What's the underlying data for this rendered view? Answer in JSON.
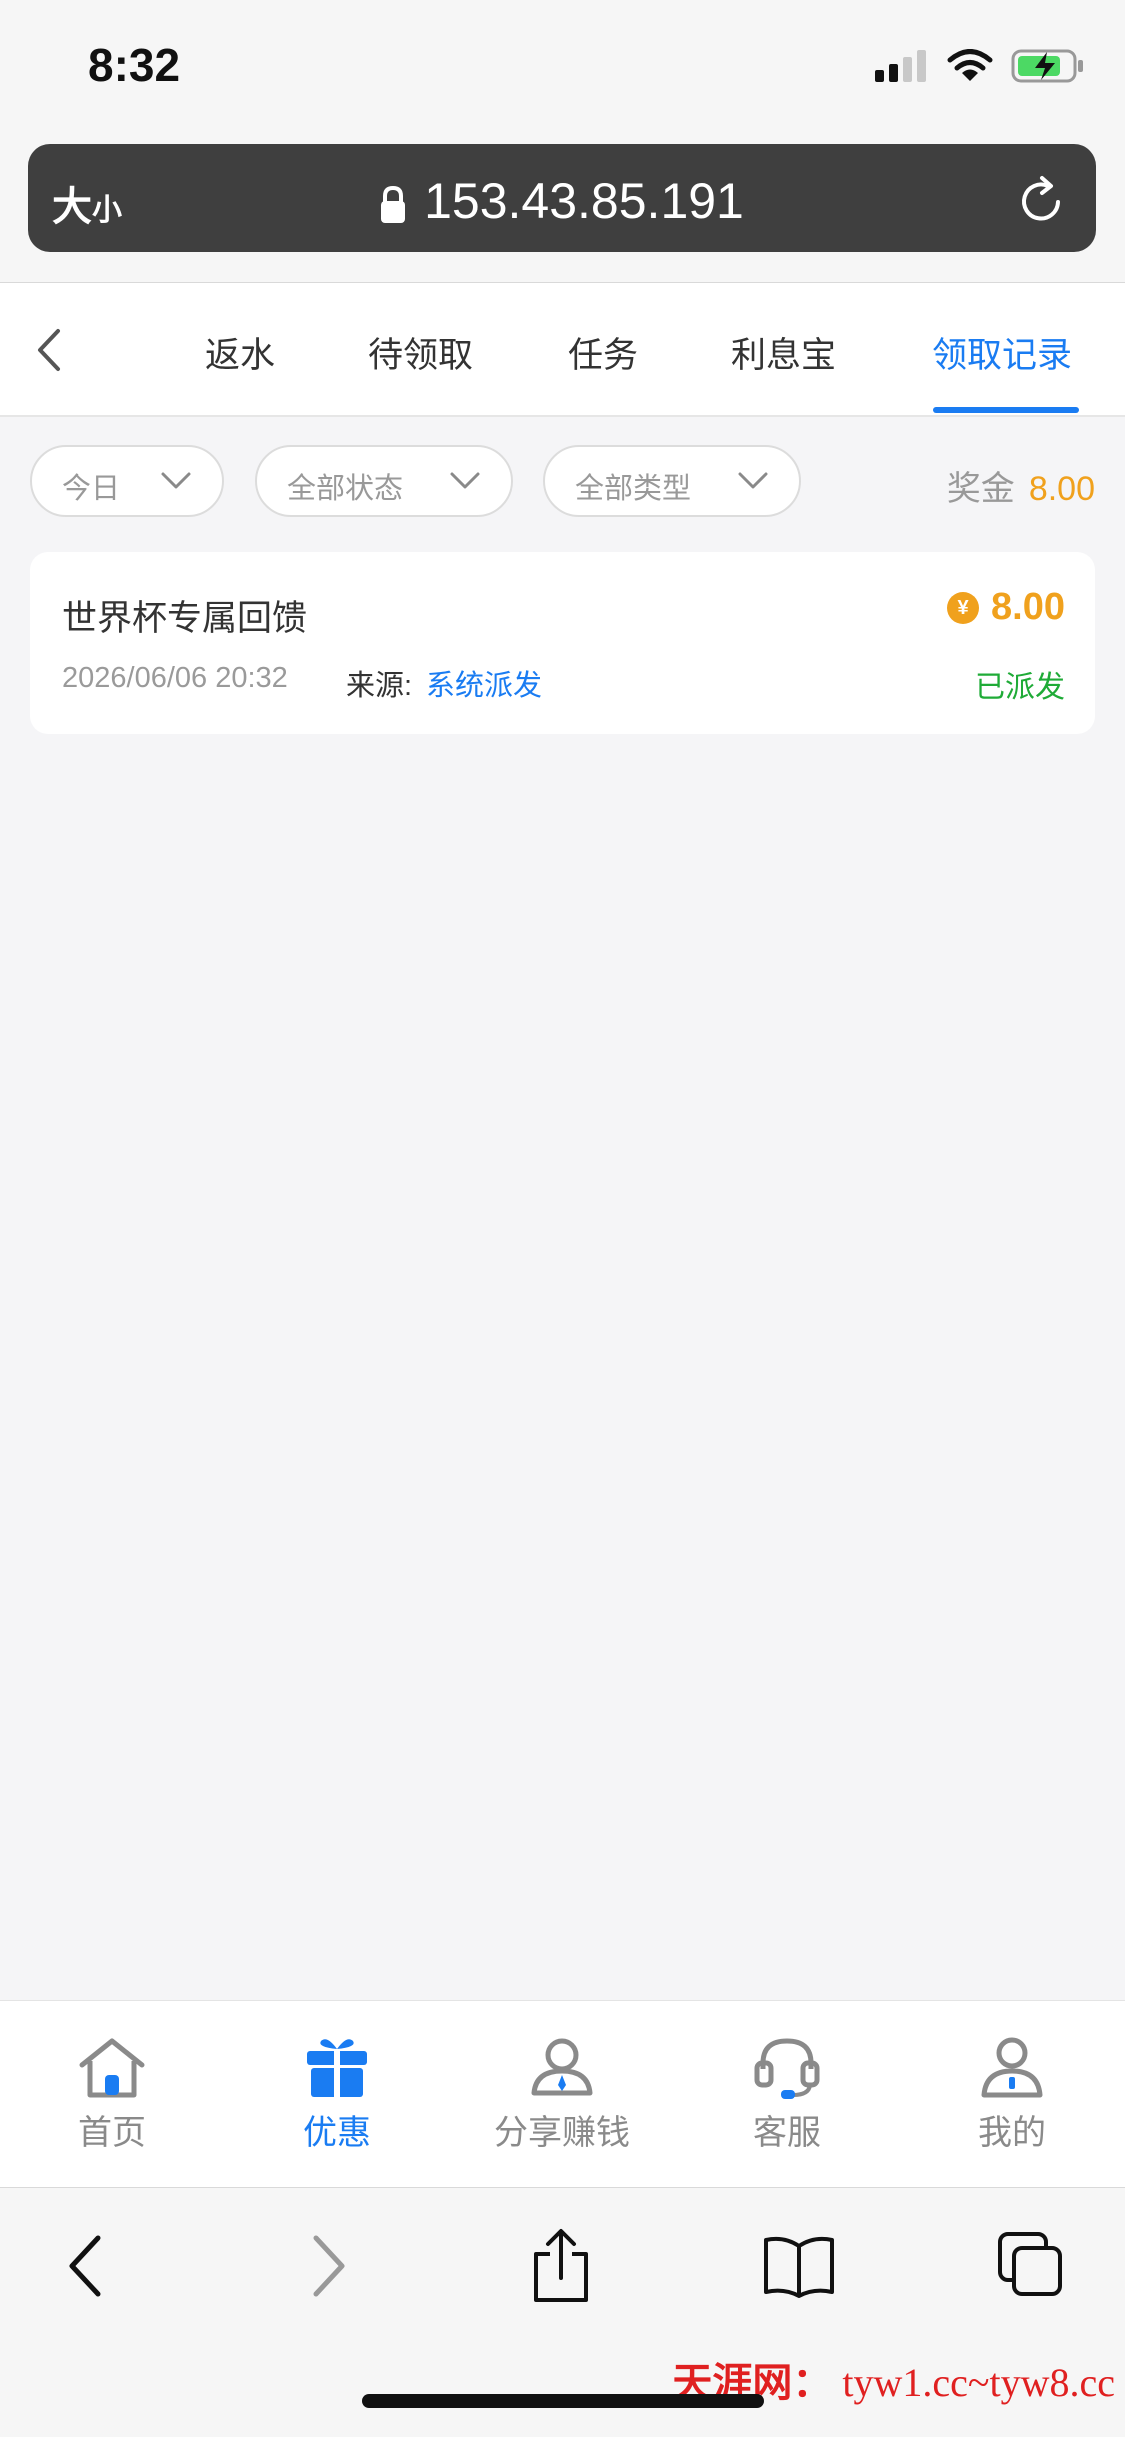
{
  "status_bar": {
    "time": "8:32"
  },
  "browser": {
    "text_size_big": "大",
    "text_size_small": "小",
    "url": "153.43.85.191"
  },
  "tabs": [
    {
      "label": "返水",
      "active": false
    },
    {
      "label": "待领取",
      "active": false
    },
    {
      "label": "任务",
      "active": false
    },
    {
      "label": "利息宝",
      "active": false
    },
    {
      "label": "领取记录",
      "active": true
    }
  ],
  "filters": {
    "date": "今日",
    "status": "全部状态",
    "type": "全部类型",
    "bonus_label": "奖金",
    "bonus_value": "8.00"
  },
  "records": [
    {
      "title": "世界杯专属回馈",
      "amount": "8.00",
      "coin_symbol": "¥",
      "datetime": "2026/06/06 20:32",
      "source_label": "来源:",
      "source": "系统派发",
      "status": "已派发"
    }
  ],
  "bottom_nav": [
    {
      "label": "首页",
      "icon": "home-icon",
      "active": false
    },
    {
      "label": "优惠",
      "icon": "gift-icon",
      "active": true
    },
    {
      "label": "分享赚钱",
      "icon": "share-people-icon",
      "active": false
    },
    {
      "label": "客服",
      "icon": "headset-icon",
      "active": false
    },
    {
      "label": "我的",
      "icon": "user-icon",
      "active": false
    }
  ],
  "watermark": {
    "brand": "天涯网：",
    "urls": "tyw1.cc~tyw8.cc"
  },
  "colors": {
    "accent": "#1a7cf2",
    "gold": "#f0a11d",
    "success": "#1fab37"
  }
}
